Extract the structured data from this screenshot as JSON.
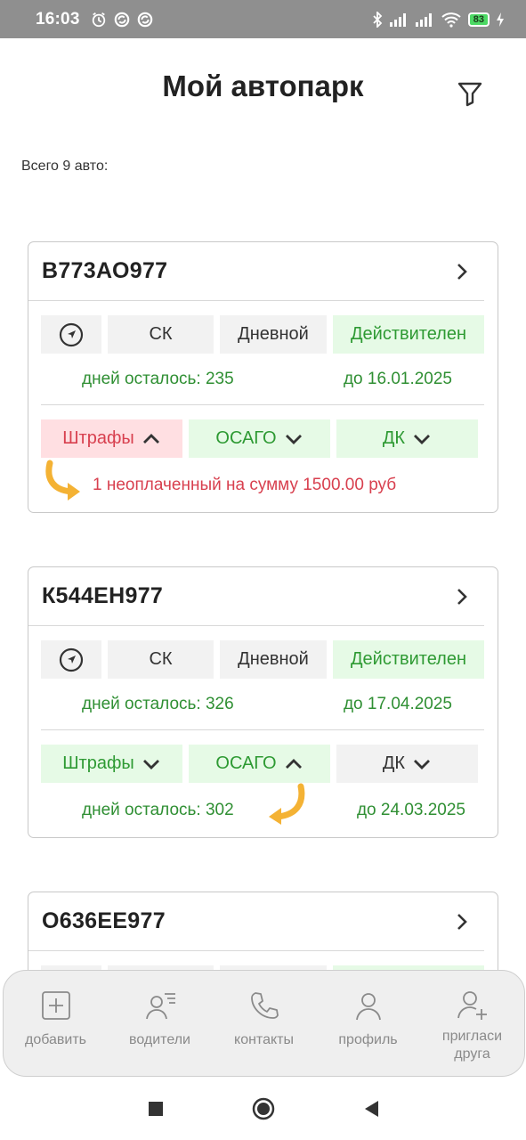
{
  "status_bar": {
    "time": "16:03",
    "battery": "83",
    "icons_left": [
      "alarm-icon",
      "sync-icon",
      "sync-icon"
    ],
    "icons_right": [
      "bluetooth-icon",
      "signal-icon",
      "signal-icon",
      "wifi-icon",
      "battery-icon",
      "charging-icon"
    ]
  },
  "header": {
    "title": "Мой автопарк",
    "filter_icon": "filter-icon"
  },
  "summary": {
    "total": "Всего 9 авто:"
  },
  "cards": [
    {
      "plate": "В773АО977",
      "nav_icon": "navigation-icon",
      "insurer": "СК",
      "mode": "Дневной",
      "status": "Действителен",
      "days_left": "дней осталось: 235",
      "until": "до 16.01.2025",
      "tabs": [
        {
          "label": "Штрафы",
          "state": "expanded",
          "tone": "red"
        },
        {
          "label": "ОСАГО",
          "state": "collapsed",
          "tone": "green"
        },
        {
          "label": "ДК",
          "state": "collapsed",
          "tone": "green"
        }
      ],
      "detail_text": "1 неоплаченный на сумму 1500.00 руб"
    },
    {
      "plate": "К544ЕН977",
      "nav_icon": "navigation-icon",
      "insurer": "СК",
      "mode": "Дневной",
      "status": "Действителен",
      "days_left": "дней осталось: 326",
      "until": "до 17.04.2025",
      "tabs": [
        {
          "label": "Штрафы",
          "state": "collapsed",
          "tone": "green"
        },
        {
          "label": "ОСАГО",
          "state": "expanded",
          "tone": "green"
        },
        {
          "label": "ДК",
          "state": "collapsed",
          "tone": "gray"
        }
      ],
      "detail_days": "дней осталось: 302",
      "detail_until": "до 24.03.2025"
    },
    {
      "plate": "О636ЕЕ977"
    }
  ],
  "bottom_nav": [
    {
      "label": "добавить",
      "icon": "add-icon"
    },
    {
      "label": "водители",
      "icon": "drivers-icon"
    },
    {
      "label": "контакты",
      "icon": "phone-icon"
    },
    {
      "label": "профиль",
      "icon": "profile-icon"
    },
    {
      "label": "пригласи друга",
      "icon": "invite-icon"
    }
  ],
  "colors": {
    "green_text": "#2e9a33",
    "green_bg": "#e6fae6",
    "red_text": "#d8404f",
    "red_bg": "#ffdfe2",
    "gray_bg": "#f2f2f2",
    "arrow_orange": "#f4b234"
  }
}
